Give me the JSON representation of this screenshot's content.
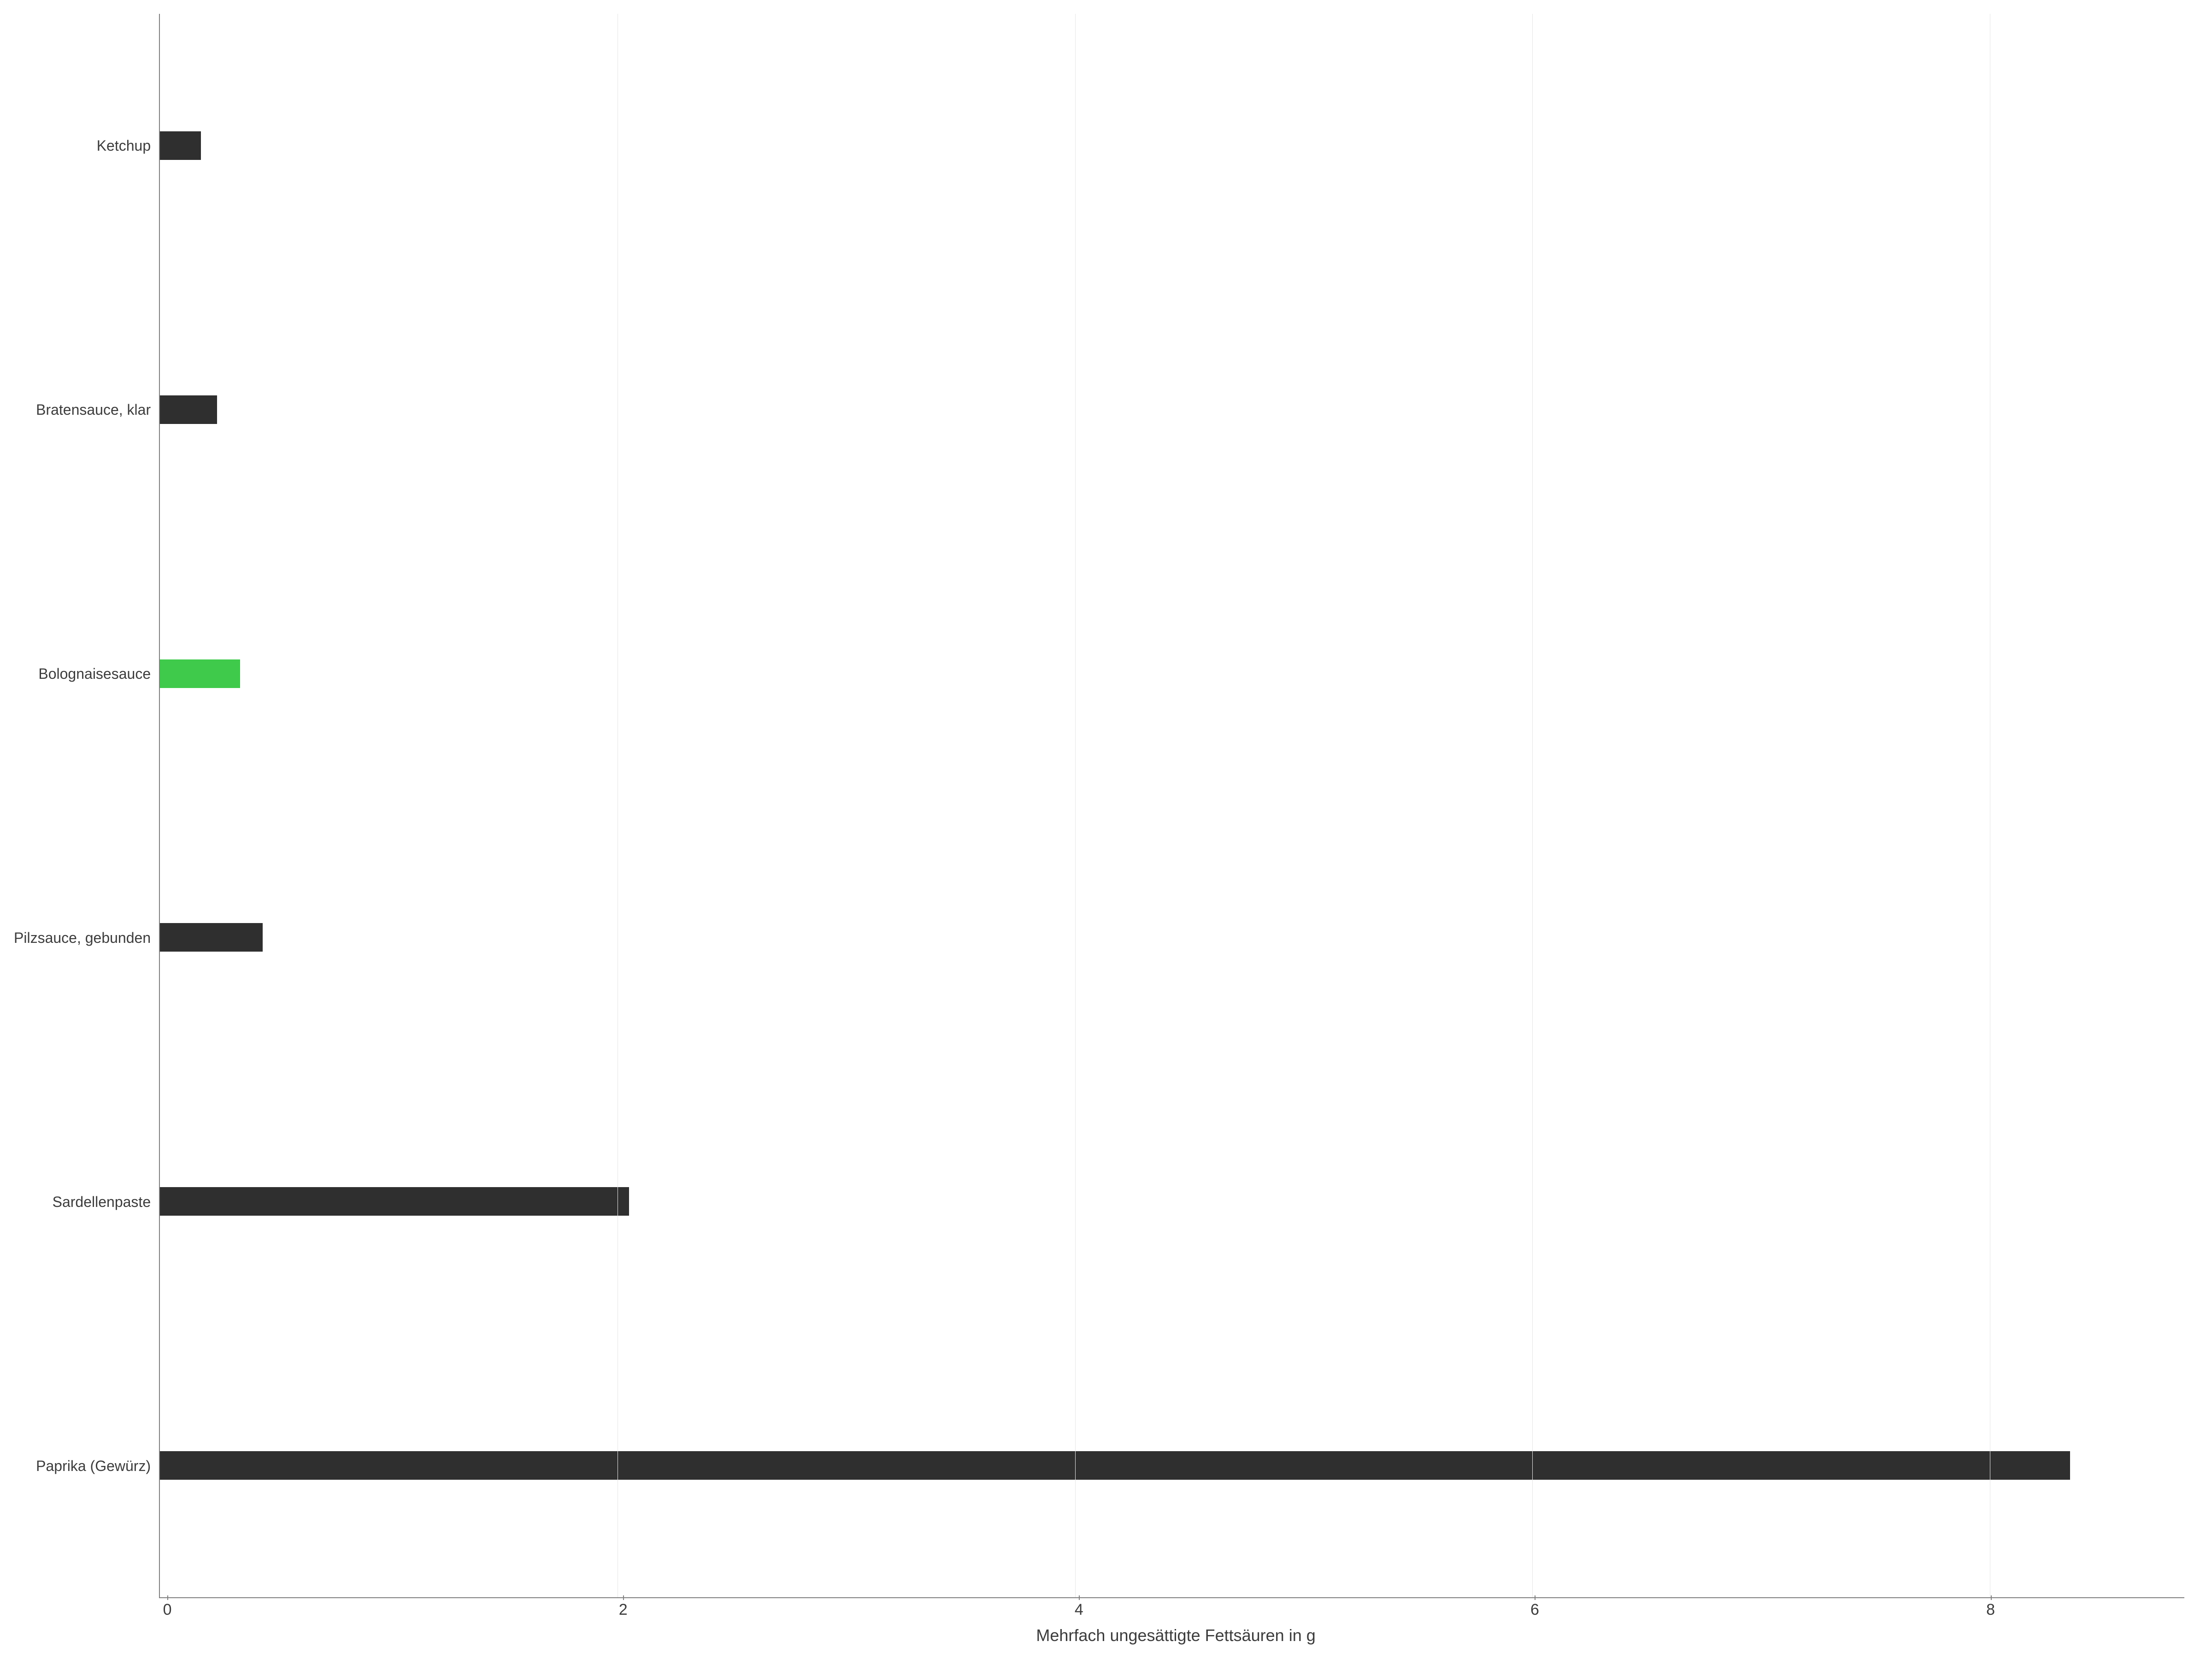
{
  "chart_data": {
    "type": "bar",
    "orientation": "horizontal",
    "categories": [
      "Ketchup",
      "Bratensauce, klar",
      "Bolognaisesauce",
      "Pilzsauce, gebunden",
      "Sardellenpaste",
      "Paprika (Gewürz)"
    ],
    "values": [
      0.18,
      0.25,
      0.35,
      0.45,
      2.05,
      8.35
    ],
    "highlight_index": 2,
    "title": "",
    "xlabel": "Mehrfach ungesättigte Fettsäuren in g",
    "ylabel": "",
    "xlim": [
      0,
      8.85
    ],
    "xticks": [
      0,
      2,
      4,
      6,
      8
    ],
    "colors": {
      "bar": "#2f2f2f",
      "highlight": "#3fca4b",
      "grid": "#e6e6e6",
      "axis": "#808080",
      "text": "#3c3c3c"
    }
  }
}
